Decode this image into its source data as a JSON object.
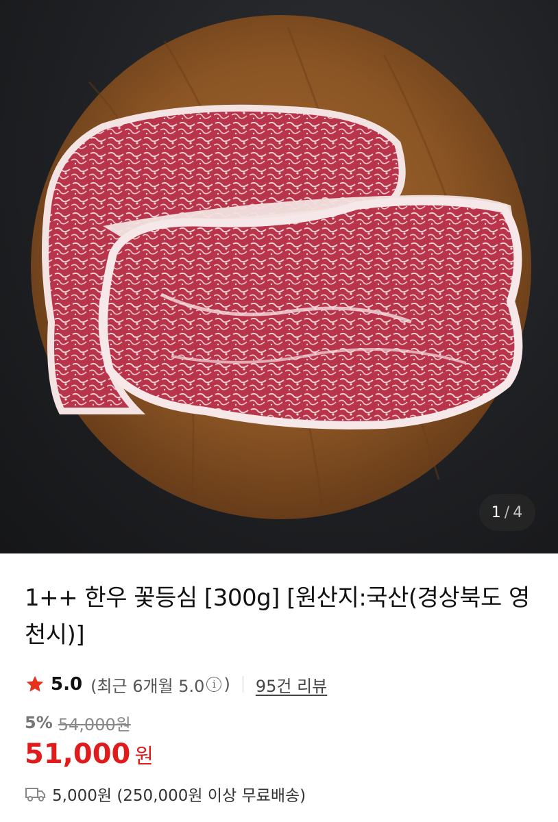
{
  "gallery": {
    "current": "1",
    "separator": "/",
    "total": "4"
  },
  "product": {
    "title": "1++ 한우 꽃등심 [300g] [원산지:국산(경상북도 영천시)]"
  },
  "rating": {
    "score": "5.0",
    "recent_prefix": "(최근 6개월 5.0",
    "recent_suffix": ")",
    "review_link": "95건 리뷰"
  },
  "price": {
    "discount": "5%",
    "original": "54,000원",
    "sale": "51,000",
    "currency": "원"
  },
  "shipping": {
    "text": "5,000원 (250,000원 이상 무료배송)"
  },
  "colors": {
    "accent": "#e01b1b"
  }
}
